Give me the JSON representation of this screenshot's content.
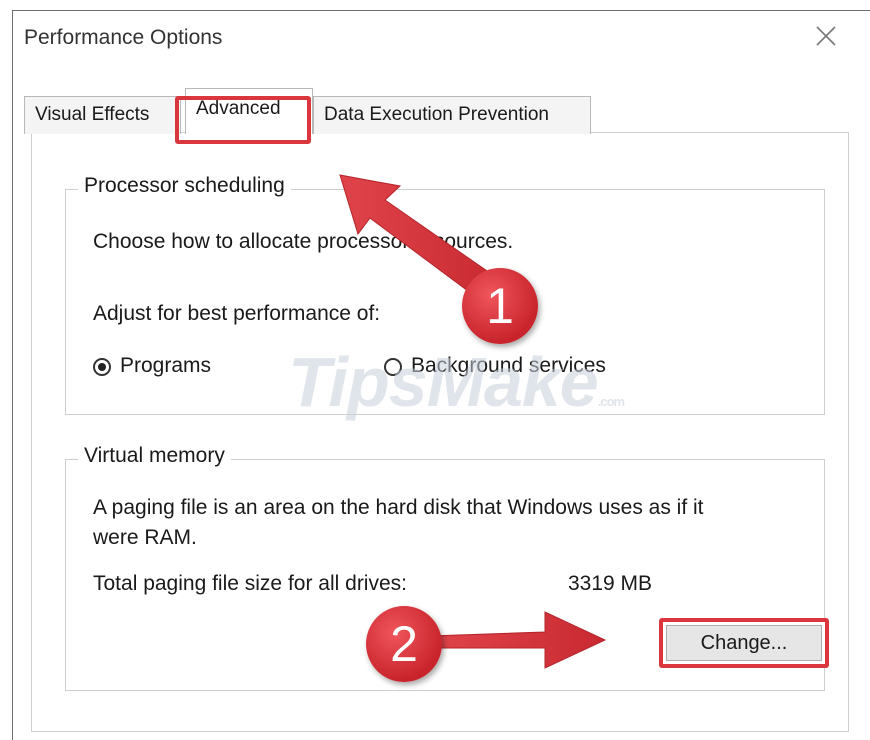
{
  "window": {
    "title": "Performance Options"
  },
  "tabs": [
    {
      "label": "Visual Effects"
    },
    {
      "label": "Advanced"
    },
    {
      "label": "Data Execution Prevention"
    }
  ],
  "processor": {
    "legend": "Processor scheduling",
    "description": "Choose how to allocate processor resources.",
    "adjust_label": "Adjust for best performance of:",
    "options": [
      {
        "label": "Programs",
        "selected": true
      },
      {
        "label": "Background services",
        "selected": false
      }
    ]
  },
  "virtual_memory": {
    "legend": "Virtual memory",
    "description_line1": "A paging file is an area on the hard disk that Windows uses as if it",
    "description_line2": "were RAM.",
    "total_label": "Total paging file size for all drives:",
    "total_value": "3319 MB",
    "change_button": "Change..."
  },
  "annotations": {
    "badge1": "1",
    "badge2": "2",
    "highlight_color": "#d9363e"
  },
  "watermark": {
    "text": "TipsMake",
    "suffix": ".com"
  }
}
